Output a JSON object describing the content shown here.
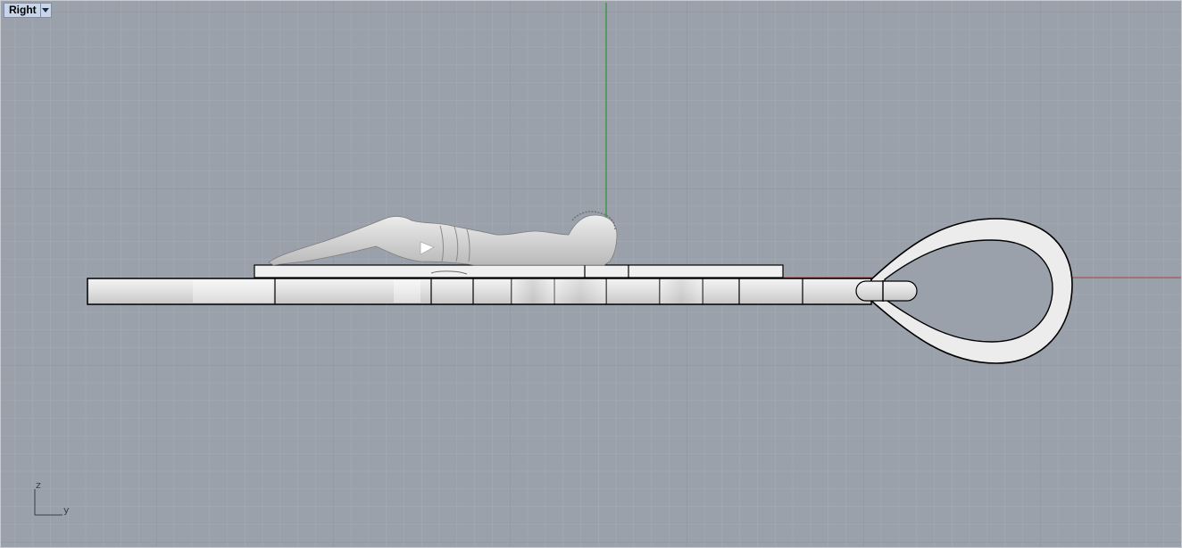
{
  "viewport": {
    "name": "Right",
    "dropdown_icon": "chevron-down-icon"
  },
  "axes_widget": {
    "vertical_axis": "z",
    "horizontal_axis": "y"
  },
  "colors": {
    "background": "#9aa1aa",
    "grid_minor": "#a7adb5",
    "grid_major": "#8c939c",
    "x_axis": "#a33a3a",
    "y_axis": "#2f8f3a",
    "tab_bg": "#c9d6ea"
  }
}
